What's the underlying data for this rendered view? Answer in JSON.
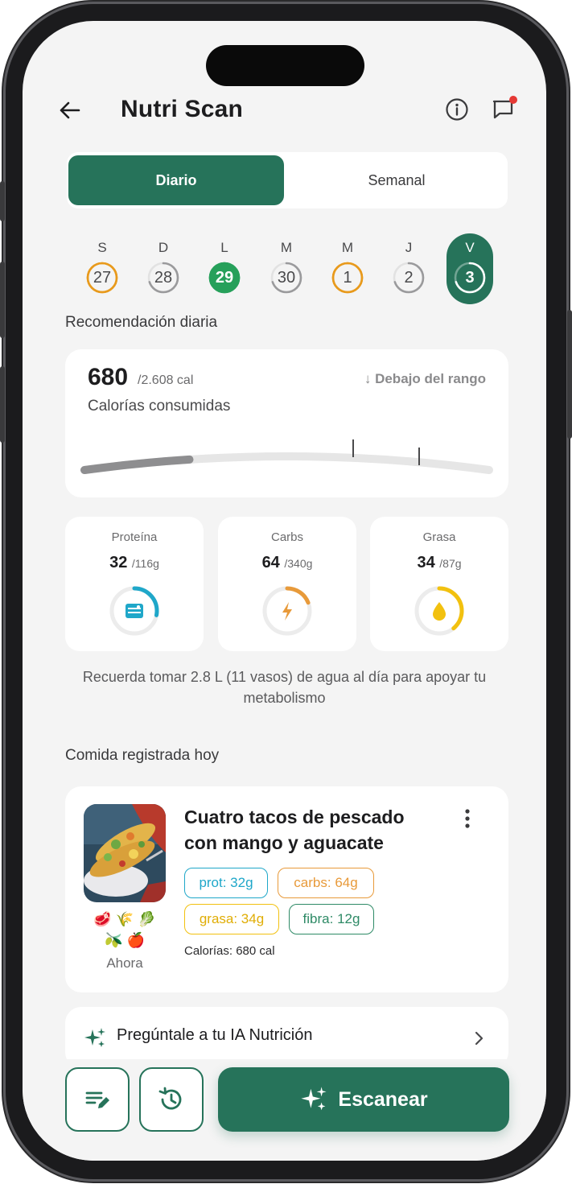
{
  "app": {
    "title": "Nutri Scan"
  },
  "tabs": [
    {
      "label": "Diario",
      "active": true
    },
    {
      "label": "Semanal",
      "active": false
    }
  ],
  "days": [
    {
      "letter": "S",
      "num": "27",
      "ring": "orange",
      "progress": 1.0
    },
    {
      "letter": "D",
      "num": "28",
      "ring": "gray",
      "progress": 0.7
    },
    {
      "letter": "L",
      "num": "29",
      "ring": "green-filled",
      "progress": 1.0
    },
    {
      "letter": "M",
      "num": "30",
      "ring": "gray",
      "progress": 0.7
    },
    {
      "letter": "M",
      "num": "1",
      "ring": "orange",
      "progress": 1.0
    },
    {
      "letter": "J",
      "num": "2",
      "ring": "gray",
      "progress": 0.7
    },
    {
      "letter": "V",
      "num": "3",
      "ring": "selected",
      "progress": 0.7
    }
  ],
  "daily": {
    "section_title": "Recomendación diaria",
    "calories": "680",
    "calories_total": "/2.608 cal",
    "label": "Calorías consumidas",
    "status": "Debajo del rango",
    "progress": 0.26
  },
  "macros": [
    {
      "name": "Proteína",
      "value": "32",
      "total": "/116g",
      "color": "#1fa7c9",
      "progress": 0.28,
      "icon": "protein-icon"
    },
    {
      "name": "Carbs",
      "value": "64",
      "total": "/340g",
      "color": "#e89a3a",
      "progress": 0.19,
      "icon": "bolt-icon"
    },
    {
      "name": "Grasa",
      "value": "34",
      "total": "/87g",
      "color": "#f2c10f",
      "progress": 0.39,
      "icon": "drop-icon"
    }
  ],
  "water_note": "Recuerda tomar 2.8 L (11 vasos) de agua al día para apoyar tu metabolismo",
  "meals": {
    "section_title": "Comida registrada hoy",
    "items": [
      {
        "title": "Cuatro tacos de pescado con mango y aguacate",
        "tags": {
          "protein": "prot: 32g",
          "carbs": "carbs: 64g",
          "fat": "grasa: 34g",
          "fiber": "fibra: 12g"
        },
        "calories": "Calorías: 680 cal",
        "time": "Ahora",
        "food_icons": [
          "🥩",
          "🌾",
          "🥬",
          "🫒",
          "🍎"
        ]
      }
    ]
  },
  "ai_row": {
    "label": "Pregúntale a tu IA Nutrición"
  },
  "actions": {
    "scan_label": "Escanear"
  },
  "colors": {
    "brand": "#26735a",
    "protein": "#1fa7c9",
    "carbs": "#e89a3a",
    "fat": "#f2c10f",
    "fiber": "#2e8a66"
  }
}
